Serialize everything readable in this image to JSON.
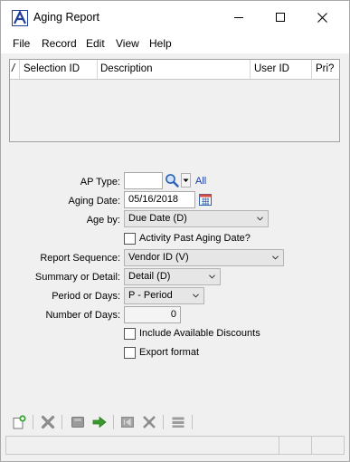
{
  "window": {
    "title": "Aging Report"
  },
  "menu": {
    "items": [
      "File",
      "Record",
      "Edit",
      "View",
      "Help"
    ]
  },
  "grid": {
    "columns": [
      "/",
      "Selection ID",
      "Description",
      "User ID",
      "Pri?"
    ],
    "rows": []
  },
  "form": {
    "ap_type": {
      "label": "AP Type:",
      "value": "",
      "all_label": "All"
    },
    "aging_date": {
      "label": "Aging Date:",
      "value": "05/16/2018"
    },
    "age_by": {
      "label": "Age by:",
      "value": "Due Date (D)"
    },
    "activity_past": {
      "label": "Activity Past Aging Date?",
      "checked": false
    },
    "report_sequence": {
      "label": "Report Sequence:",
      "value": "Vendor ID (V)"
    },
    "summary_detail": {
      "label": "Summary or Detail:",
      "value": "Detail (D)"
    },
    "period_days": {
      "label": "Period or Days:",
      "value": "P - Period"
    },
    "number_of_days": {
      "label": "Number of Days:",
      "value": "0"
    },
    "include_discounts": {
      "label": "Include Available Discounts",
      "checked": false
    },
    "export_format": {
      "label": "Export format",
      "checked": false
    }
  },
  "toolbar": {
    "icons": [
      "new-record-icon",
      "delete-icon",
      "save-icon",
      "go-arrow-icon",
      "first-icon",
      "collapse-icon",
      "list-icon"
    ]
  },
  "colors": {
    "accent_link": "#1a3aa8",
    "logo": "#1f3f9a",
    "go_arrow": "#3a9a2e"
  }
}
